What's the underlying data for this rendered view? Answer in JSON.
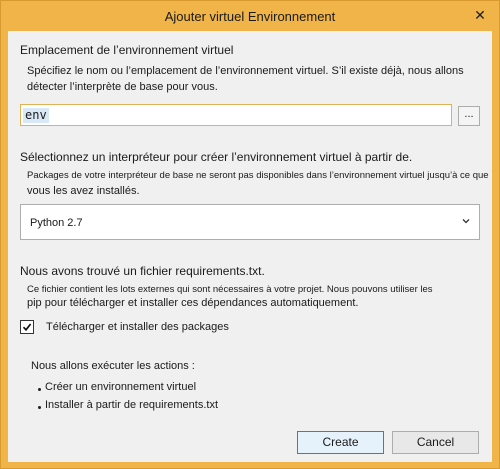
{
  "window": {
    "title": "Ajouter virtuel  Environnement",
    "close_label": "✕"
  },
  "location": {
    "heading": "Emplacement de l’environnement virtuel",
    "description_line1": "Spécifiez le nom ou l’emplacement de l’environnement virtuel. S’il existe déjà, nous allons",
    "description_line2": "détecter l’interprète de base pour vous.",
    "input_value": "env",
    "browse_label": "..."
  },
  "interpreter": {
    "heading": "Sélectionnez un interpréteur pour créer l’environnement virtuel à partir de.",
    "note_line1": "Packages de votre interpréteur de base ne seront pas disponibles dans l’environnement virtuel jusqu’à ce que",
    "note_line2": "vous les avez installés.",
    "selected": "Python 2.7"
  },
  "requirements": {
    "heading": "Nous avons trouvé un fichier requirements.txt.",
    "description_line1": "Ce fichier contient les lots externes qui sont nécessaires à votre projet. Nous pouvons utiliser les",
    "description_line2": "pip pour télécharger et installer ces dépendances automatiquement.",
    "checkbox_label": "Télécharger et installer des packages",
    "checked": true
  },
  "actions": {
    "heading": "Nous allons exécuter les actions :",
    "items": [
      "Créer un environnement virtuel",
      "Installer à partir de requirements.txt"
    ]
  },
  "buttons": {
    "create": "Create",
    "cancel": "Cancel"
  },
  "colors": {
    "title_bar": "#f0b448",
    "client_bg": "#f0f0f0",
    "input_border": "#e3b155",
    "primary_border": "#3c7fb1"
  },
  "icons": {
    "close": "close-icon",
    "dropdown": "chevron-down-icon",
    "check": "checkmark-icon"
  }
}
